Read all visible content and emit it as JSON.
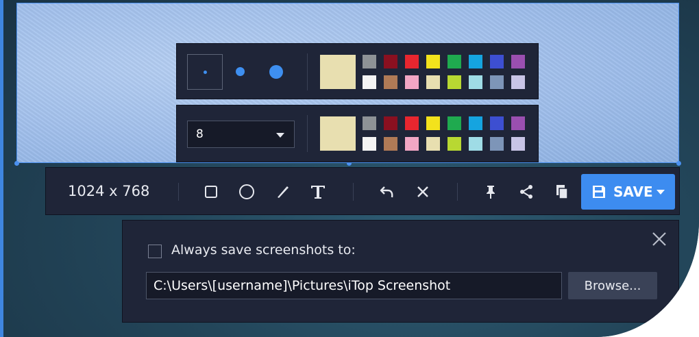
{
  "colors": {
    "accent": "#3d8cf0",
    "panel_bg": "#1f2538",
    "swatch_selected": "#e8dfb0",
    "palette": [
      [
        "#8e9296",
        "#8a1020",
        "#e8262f",
        "#f3e21c",
        "#1faa4f",
        "#15a4e0",
        "#3d4fd1",
        "#9a4fb0"
      ],
      [
        "#f4f4f4",
        "#b07a56",
        "#f2a6c4",
        "#e8dfb0",
        "#b8d832",
        "#9fdce6",
        "#7d95b8",
        "#c8c4e6"
      ]
    ]
  },
  "brush_sizes": [
    "small-dot-icon",
    "medium-dot-icon",
    "large-dot-icon"
  ],
  "font_size": {
    "value": "8"
  },
  "toolbar": {
    "dimensions": "1024 x 768",
    "tools": [
      "rectangle-icon",
      "ellipse-icon",
      "pen-icon",
      "text-icon",
      "undo-icon",
      "close-icon",
      "pin-icon",
      "share-icon",
      "copy-icon"
    ],
    "save_label": "SAVE"
  },
  "dialog": {
    "checkbox_label": "Always save screenshots to:",
    "path": "C:\\Users\\[username]\\Pictures\\iTop Screenshot",
    "browse_label": "Browse..."
  }
}
